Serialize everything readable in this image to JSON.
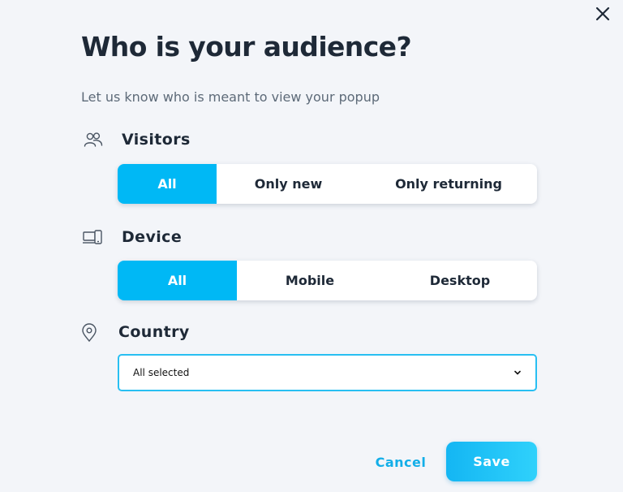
{
  "dialog": {
    "title": "Who is your audience?",
    "subtitle": "Let us know who is meant to view your popup"
  },
  "icons": {
    "close": "close-icon",
    "visitors": "users-icon",
    "device": "devices-icon",
    "country": "location-pin-icon",
    "select": "chevron-down-icon"
  },
  "visitors": {
    "label": "Visitors",
    "options": [
      "All",
      "Only new",
      "Only returning"
    ],
    "selected": "All"
  },
  "device": {
    "label": "Device",
    "options": [
      "All",
      "Mobile",
      "Desktop"
    ],
    "selected": "All"
  },
  "country": {
    "label": "Country",
    "value": "All selected"
  },
  "actions": {
    "cancel": "Cancel",
    "save": "Save"
  },
  "colors": {
    "accent": "#00b8f5",
    "title": "#1e2937",
    "background": "#f3f5f9"
  }
}
